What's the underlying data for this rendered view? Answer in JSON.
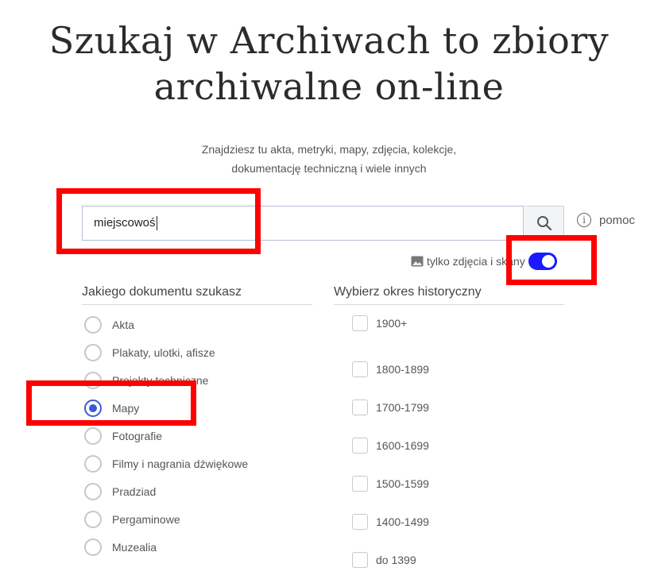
{
  "header": {
    "title_line1": "Szukaj w Archiwach to zbiory",
    "title_line2": "archiwalne on-line",
    "subtitle_line1": "Znajdziesz tu akta, metryki, mapy, zdjęcia, kolekcje,",
    "subtitle_line2": "dokumentację techniczną i wiele innych"
  },
  "search": {
    "value": "miejscowoś",
    "help_label": "pomoc",
    "scans_label": "tylko zdjęcia i skany",
    "scans_enabled": true
  },
  "document_types": {
    "heading": "Jakiego dokumentu szukasz",
    "options": [
      {
        "label": "Akta",
        "checked": false
      },
      {
        "label": "Plakaty, ulotki, afisze",
        "checked": false
      },
      {
        "label": "Projekty techniczne",
        "checked": false
      },
      {
        "label": "Mapy",
        "checked": true
      },
      {
        "label": "Fotografie",
        "checked": false
      },
      {
        "label": "Filmy i nagrania dźwiękowe",
        "checked": false
      },
      {
        "label": "Pradziad",
        "checked": false
      },
      {
        "label": "Pergaminowe",
        "checked": false
      },
      {
        "label": "Muzealia",
        "checked": false
      }
    ]
  },
  "periods": {
    "heading": "Wybierz okres historyczny",
    "options": [
      {
        "label": "1900+",
        "checked": false
      },
      {
        "label": "1800-1899",
        "checked": false
      },
      {
        "label": "1700-1799",
        "checked": false
      },
      {
        "label": "1600-1699",
        "checked": false
      },
      {
        "label": "1500-1599",
        "checked": false
      },
      {
        "label": "1400-1499",
        "checked": false
      },
      {
        "label": "do 1399",
        "checked": false
      }
    ]
  },
  "colors": {
    "highlight": "#ff0000",
    "toggle": "#1a1aff",
    "radio_checked": "#3a5bd9"
  }
}
